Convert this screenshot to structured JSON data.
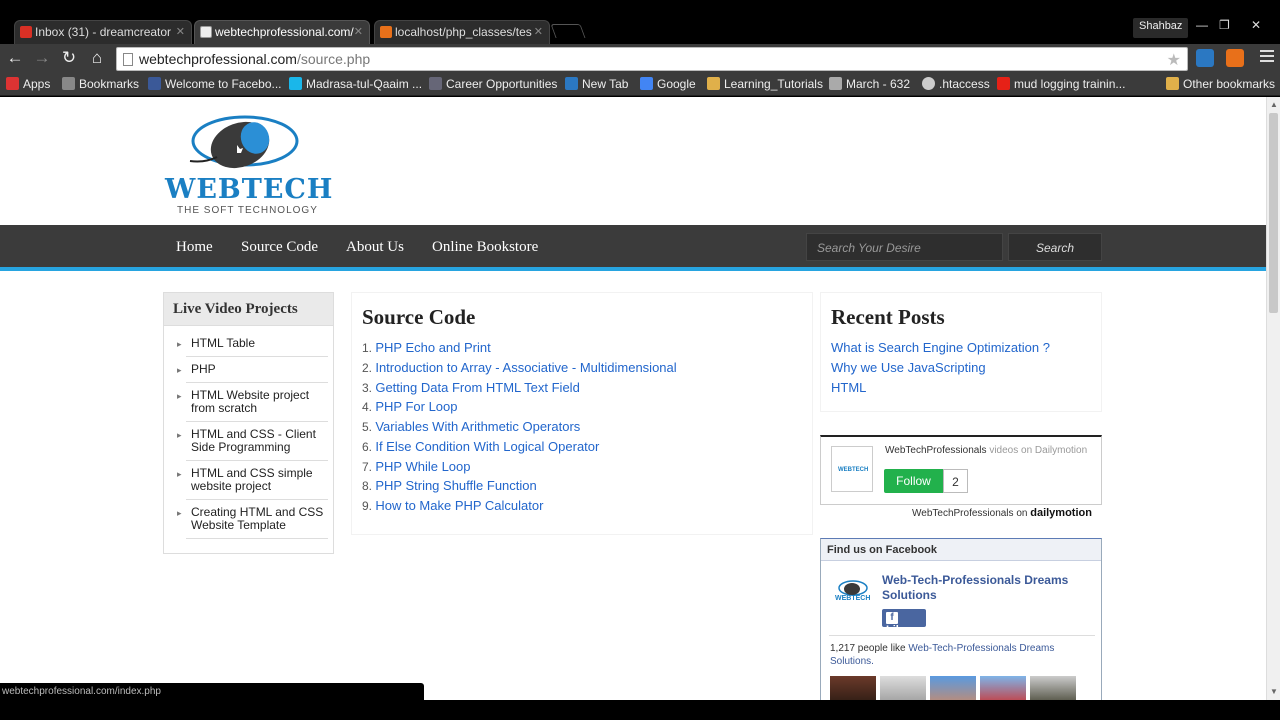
{
  "browser": {
    "tabs": [
      {
        "title": "Inbox (31) - dreamcreator",
        "icon": "gmail-icon",
        "active": false
      },
      {
        "title": "webtechprofessional.com/",
        "icon": "page-icon",
        "active": true
      },
      {
        "title": "localhost/php_classes/tes",
        "icon": "xampp-icon",
        "active": false
      }
    ],
    "profile_name": "Shahbaz",
    "url_host": "webtechprofessional.com",
    "url_path": "/source.php",
    "bookmarks": [
      {
        "label": "Apps",
        "icon": "apps-grid-icon"
      },
      {
        "label": "Bookmarks",
        "icon": "star-icon"
      },
      {
        "label": "Welcome to Facebo...",
        "icon": "facebook-icon"
      },
      {
        "label": "Madrasa-tul-Qaaim ...",
        "icon": "vimeo-icon"
      },
      {
        "label": "Career Opportunities",
        "icon": "career-icon"
      },
      {
        "label": "New Tab",
        "icon": "yahoo-icon"
      },
      {
        "label": "Google",
        "icon": "google-icon"
      },
      {
        "label": "Learning_Tutorials",
        "icon": "folder-icon"
      },
      {
        "label": "March - 632",
        "icon": "moon-icon"
      },
      {
        "label": ".htaccess",
        "icon": "gear-icon"
      },
      {
        "label": "mud logging trainin...",
        "icon": "youtube-icon"
      }
    ],
    "other_bookmarks": "Other bookmarks",
    "status_url": "webtechprofessional.com/index.php"
  },
  "site": {
    "logo_text": "WEBTECH",
    "logo_tagline": "THE SOFT TECHNOLOGY",
    "nav": [
      "Home",
      "Source Code",
      "About Us",
      "Online Bookstore"
    ],
    "search_placeholder": "Search Your Desire",
    "search_button": "Search"
  },
  "left_sidebar": {
    "title": "Live Video Projects",
    "items": [
      "HTML Table",
      "PHP",
      "HTML Website project from scratch",
      "HTML and CSS - Client Side Programming",
      "HTML and CSS simple website project",
      "Creating HTML and CSS Website Template"
    ]
  },
  "main": {
    "title": "Source Code",
    "items": [
      "PHP Echo and Print",
      "Introduction to Array - Associative - Multidimensional",
      "Getting Data From HTML Text Field",
      "PHP For Loop",
      "Variables With Arithmetic Operators",
      "If Else Condition With Logical Operator",
      "PHP While Loop",
      "PHP String Shuffle Function",
      "How to Make PHP Calculator"
    ]
  },
  "recent": {
    "title": "Recent Posts",
    "items": [
      "What is Search Engine Optimization ?",
      "Why we Use JavaScripting",
      "HTML"
    ]
  },
  "dailymotion": {
    "channel": "WebTechProfessionals",
    "suffix": "videos on Dailymotion",
    "follow_label": "Follow",
    "follow_count": "2",
    "footer_channel": "WebTechProfessionals",
    "footer_on": "on",
    "brand": "dailymotion",
    "mini_logo": "WEBTECH"
  },
  "facebook": {
    "header": "Find us on Facebook",
    "page_name": "Web-Tech-Professionals Dreams Solutions",
    "like_label": "Like",
    "like_count_text": "1,217 people like",
    "page_name_short": "Web-Tech-Professionals Dreams Solutions.",
    "mini_logo": "WEBTECH"
  },
  "colors": {
    "accent": "#27a4e0",
    "link": "#2266cc",
    "nav_bg": "#3b3b3b",
    "follow_green": "#22b14c",
    "facebook_blue": "#4a66a0"
  }
}
